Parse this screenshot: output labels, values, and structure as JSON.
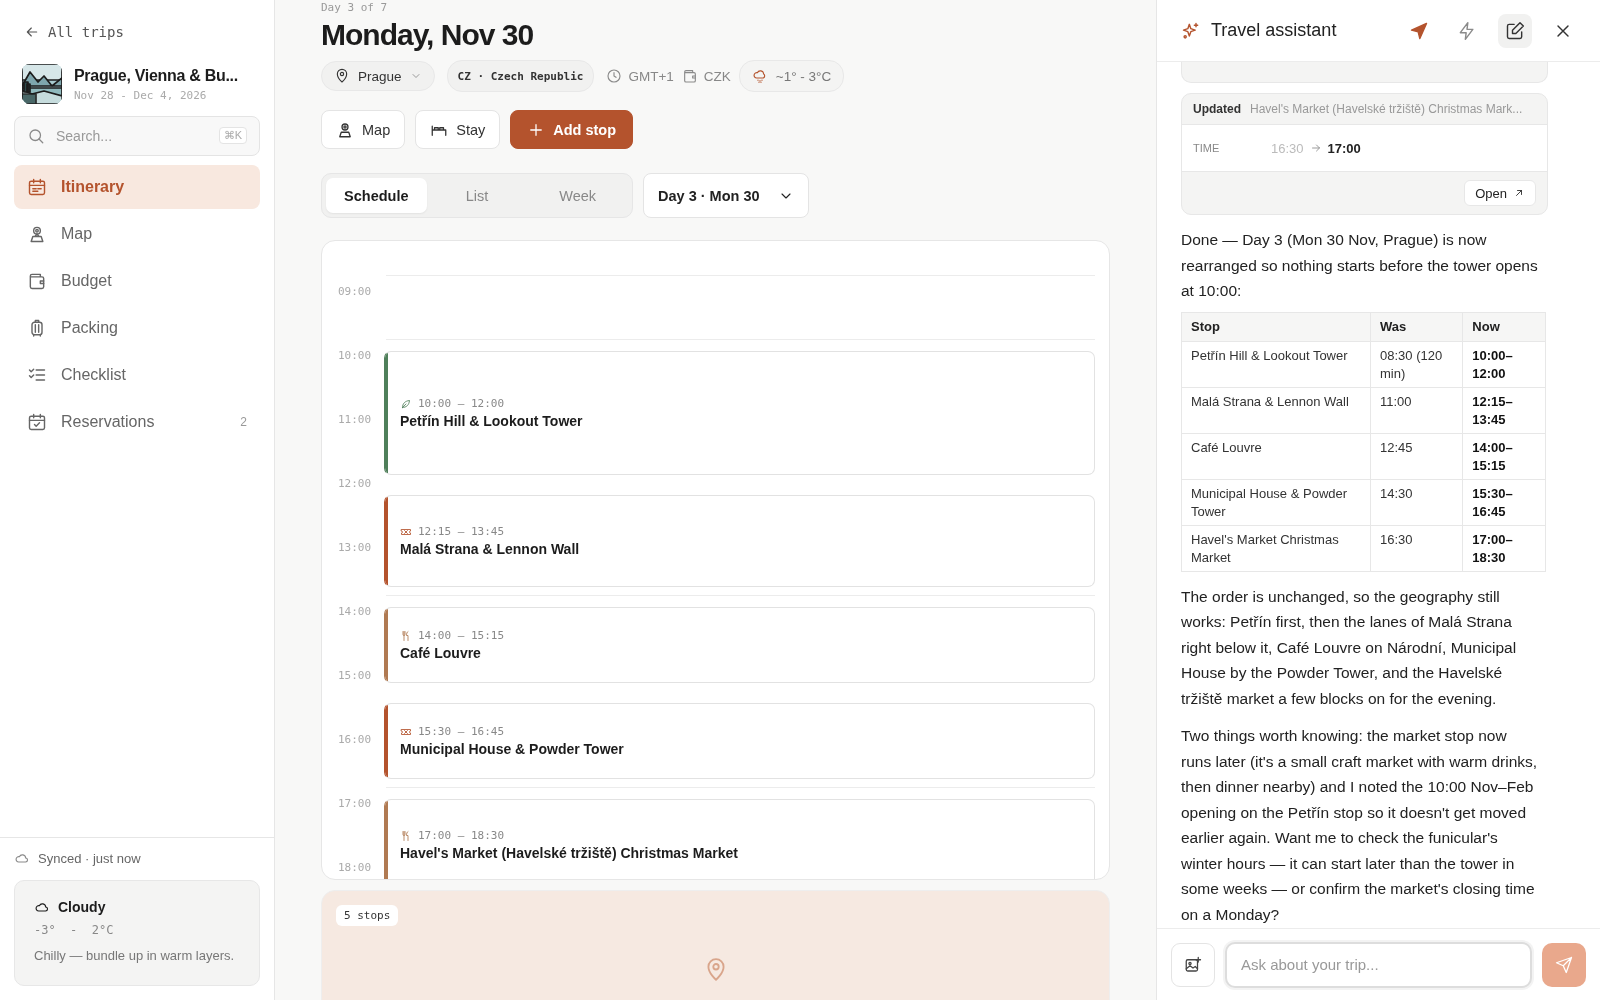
{
  "sidebar": {
    "back_link": "All trips",
    "trip": {
      "title": "Prague, Vienna & Bu...",
      "dates": "Nov 28 - Dec 4, 2026"
    },
    "search": {
      "placeholder": "Search...",
      "shortcut": "⌘K"
    },
    "items": [
      {
        "label": "Itinerary",
        "selected": true
      },
      {
        "label": "Map",
        "selected": false
      },
      {
        "label": "Budget",
        "selected": false
      },
      {
        "label": "Packing",
        "selected": false
      },
      {
        "label": "Checklist",
        "selected": false
      },
      {
        "label": "Reservations",
        "selected": false,
        "count": "2"
      }
    ],
    "sync_status": "Synced · just now",
    "weather": {
      "title": "Cloudy",
      "range": "-3°  -  2°C",
      "note": "Chilly — bundle up in warm layers."
    }
  },
  "day": {
    "eyebrow": "Day 3 of 7",
    "title": "Monday, Nov 30",
    "chips": [
      {
        "kind": "city",
        "label": "Prague"
      },
      {
        "kind": "country",
        "label": "CZ · Czech Republic"
      },
      {
        "kind": "timezone",
        "label": "GMT+1"
      },
      {
        "kind": "currency",
        "label": "CZK"
      },
      {
        "kind": "weather",
        "label": "~1° - 3°C"
      }
    ],
    "actions": [
      {
        "kind": "map",
        "label": "Map"
      },
      {
        "kind": "stay",
        "label": "Stay"
      },
      {
        "kind": "add",
        "label": "Add stop"
      }
    ],
    "views": [
      {
        "label": "Schedule",
        "selected": true
      },
      {
        "label": "List",
        "selected": false
      },
      {
        "label": "Week",
        "selected": false
      }
    ],
    "day_picker": "Day 3 · Mon 30"
  },
  "schedule": {
    "hours": [
      "09:00",
      "10:00",
      "11:00",
      "12:00",
      "13:00",
      "14:00",
      "15:00",
      "16:00",
      "17:00",
      "18:00"
    ],
    "events": [
      {
        "kind": "sight",
        "time": "10:00 – 12:00",
        "title": "Petřín Hill & Lookout Tower",
        "color": "#4f7f5a"
      },
      {
        "kind": "ticket",
        "time": "12:15 – 13:45",
        "title": "Malá Strana & Lennon Wall",
        "color": "#b4532d"
      },
      {
        "kind": "food",
        "time": "14:00 – 15:15",
        "title": "Café Louvre",
        "color": "#b07a52"
      },
      {
        "kind": "ticket",
        "time": "15:30 – 16:45",
        "title": "Municipal House & Powder Tower",
        "color": "#b4532d"
      },
      {
        "kind": "food",
        "time": "17:00 – 18:30",
        "title": "Havel's Market (Havelské tržiště) Christmas Market",
        "color": "#b07a52"
      }
    ]
  },
  "stops_card": {
    "badge": "5 stops"
  },
  "assistant": {
    "title": "Travel assistant",
    "update": {
      "status": "Updated",
      "subject": "Havel's Market (Havelské tržiště) Christmas Mark...",
      "field": "TIME",
      "old": "16:30",
      "new": "17:00",
      "open": "Open"
    },
    "intro": "Done — Day 3 (Mon 30 Nov, Prague) is now rearranged so nothing starts before the tower opens at 10:00:",
    "table": {
      "columns": [
        "Stop",
        "Was",
        "Now"
      ],
      "rows": [
        [
          "Petřín Hill & Lookout Tower",
          "08:30 (120 min)",
          "10:00–12:00"
        ],
        [
          "Malá Strana & Lennon Wall",
          "11:00",
          "12:15–13:45"
        ],
        [
          "Café Louvre",
          "12:45",
          "14:00–15:15"
        ],
        [
          "Municipal House & Powder Tower",
          "14:30",
          "15:30–16:45"
        ],
        [
          "Havel's Market Christmas Market",
          "16:30",
          "17:00–18:30"
        ]
      ]
    },
    "paragraphs": [
      "The order is unchanged, so the geography still works: Petřín first, then the lanes of Malá Strana right below it, Café Louvre on Národní, Municipal House by the Powder Tower, and the Havelské tržiště market a few blocks on for the evening.",
      "Two things worth knowing: the market stop now runs later (it's a small craft market with warm drinks, then dinner nearby) and I noted the 10:00 Nov–Feb opening on the Petřín stop so it doesn't get moved earlier again. Want me to check the funicular's winter hours — it can start later than the tower in some weeks — or confirm the market's closing time on a Monday?"
    ],
    "input": {
      "placeholder": "Ask about your trip..."
    }
  }
}
